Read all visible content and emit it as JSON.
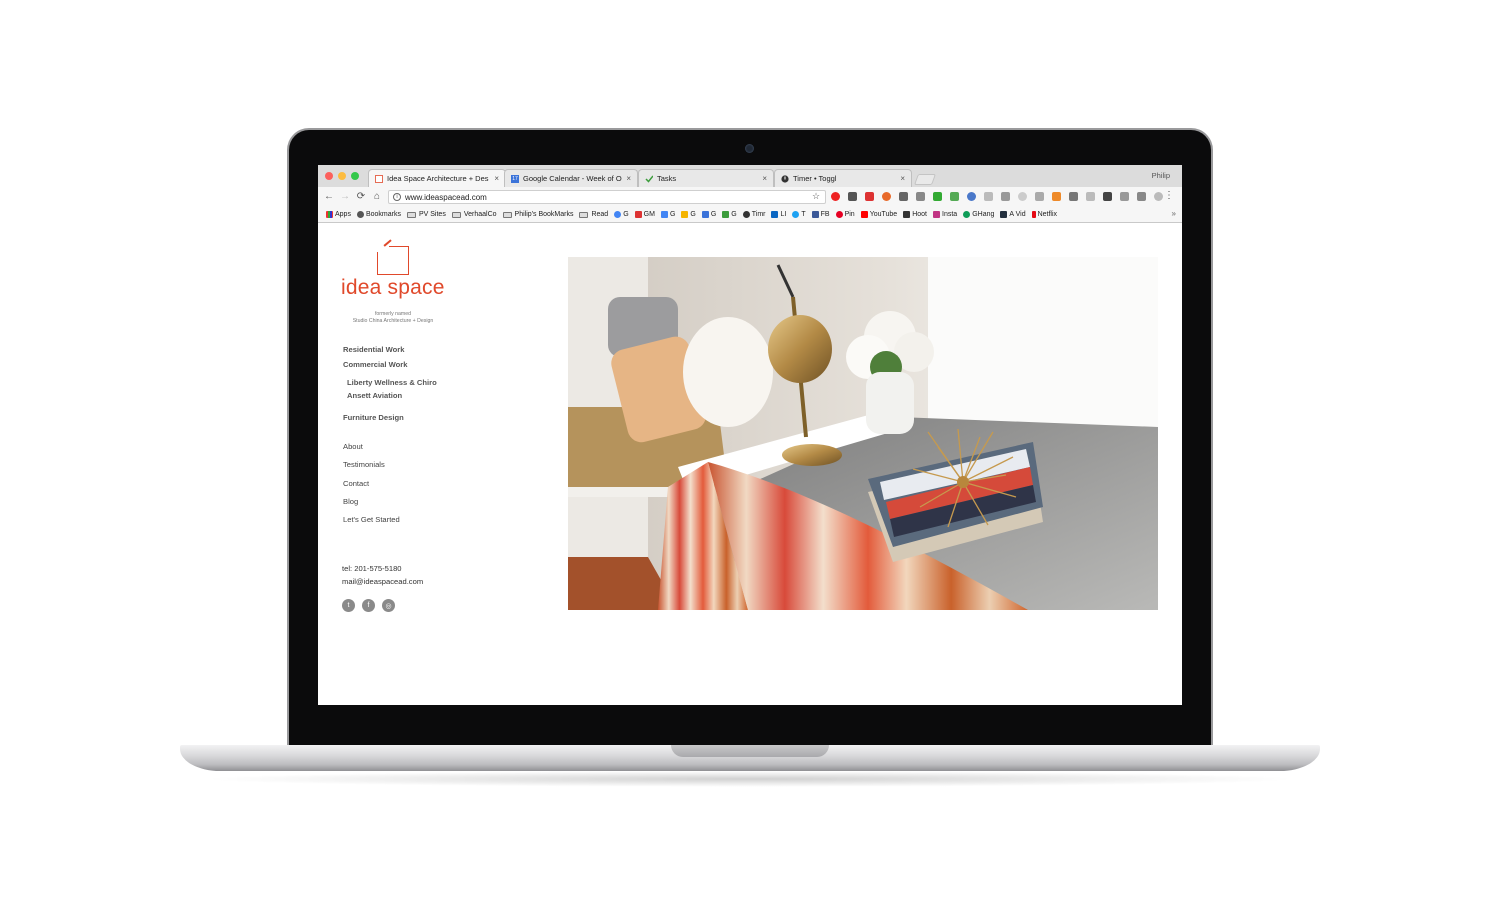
{
  "browser": {
    "tabs": [
      {
        "title": "Idea Space Architecture + Des",
        "active": true
      },
      {
        "title": "Google Calendar - Week of Oc",
        "active": false
      },
      {
        "title": "Tasks",
        "active": false
      },
      {
        "title": "Timer • Toggl",
        "active": false
      }
    ],
    "calendar_icon_text": "17",
    "tab_close": "×",
    "profile": "Philip",
    "url": "www.ideaspacead.com",
    "info_symbol": "i",
    "nav": {
      "back": "←",
      "forward": "→",
      "reload": "⟳",
      "home": "⌂"
    },
    "star": "☆",
    "menu": "⋮",
    "bookmarks": [
      "Apps",
      "Bookmarks",
      "PV Sites",
      "VerhaalCo",
      "Philip's BookMarks",
      "Read",
      "G",
      "GM",
      "G",
      "G",
      "G",
      "G",
      "Timr",
      "LI",
      "T",
      "FB",
      "Pin",
      "YouTube",
      "Hoot",
      "Insta",
      "GHang",
      "A Vid",
      "Netflix"
    ],
    "bookmarks_more": "»"
  },
  "site": {
    "logo_text": "idea space",
    "tagline_1": "formerly named",
    "tagline_2": "Studio China Architecture + Design",
    "nav": {
      "residential": "Residential Work",
      "commercial": "Commercial Work",
      "liberty": "Liberty Wellness & Chiro",
      "ansett": "Ansett Aviation",
      "furniture": "Furniture Design",
      "about": "About",
      "testimonials": "Testimonials",
      "contact": "Contact",
      "blog": "Blog",
      "started": "Let's Get Started"
    },
    "phone": "tel: 201-575-5180",
    "email": "mail@ideaspacead.com",
    "social": {
      "twitter": "t",
      "facebook": "f",
      "instagram": "◎"
    }
  },
  "colors": {
    "brand": "#e0492b",
    "nav_text": "#555555"
  }
}
